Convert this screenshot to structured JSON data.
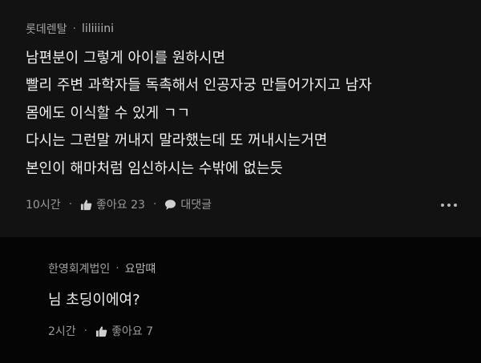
{
  "comment": {
    "author": "롯데렌탈",
    "separator": "·",
    "username": "liliiiini",
    "lines": [
      "남편분이 그렇게 아이를 원하시면",
      "빨리 주변 과학자들 독촉해서 인공자궁 만들어가지고 남자",
      "몸에도 이식할 수 있게 ㄱㄱ",
      "다시는 그런말 꺼내지 말라했는데 또 꺼내시는거면",
      "본인이 해마처럼 임신하시는 수밖에 없는듯"
    ],
    "time": "10시간",
    "like_label": "좋아요 23",
    "reply_label": "대댓글",
    "action_separator": "·"
  },
  "reply": {
    "author": "한영회계법인",
    "separator": "·",
    "username": "요맘떄",
    "text": "님 초딩이에여?",
    "time": "2시간",
    "like_label": "좋아요 7",
    "action_separator": "·"
  },
  "icons": {
    "like": "thumbs-up-icon",
    "reply": "speech-bubble-icon",
    "more": "more-dots-icon"
  },
  "colors": {
    "comment_bg": "#121212",
    "reply_bg": "#050505",
    "text": "#efefef",
    "meta": "#9a9a9a"
  }
}
